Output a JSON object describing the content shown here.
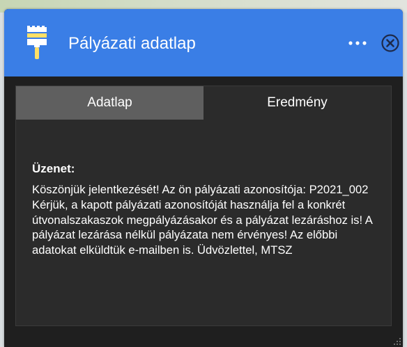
{
  "window": {
    "title": "Pályázati adatlap",
    "header_color": "#3a7ee6",
    "icons": {
      "app_icon": "paint-brush-icon",
      "menu_icon": "more-icon",
      "close_icon": "close-icon"
    }
  },
  "tabs": [
    {
      "label": "Adatlap",
      "active": true
    },
    {
      "label": "Eredmény",
      "active": false
    }
  ],
  "message": {
    "heading": "Üzenet:",
    "text": "Köszönjük jelentkezését! Az ön pályázati azonosítója: P2021_002 Kérjük, a kapott pályázati azonosítóját használja fel a konkrét útvonalszakaszok megpályázásakor és a pályázat lezáráshoz is! A pályázat lezárása nélkül pályázata nem érvényes! Az előbbi adatokat elküldtük e-mailben is. Üdvözlettel, MTSZ"
  }
}
